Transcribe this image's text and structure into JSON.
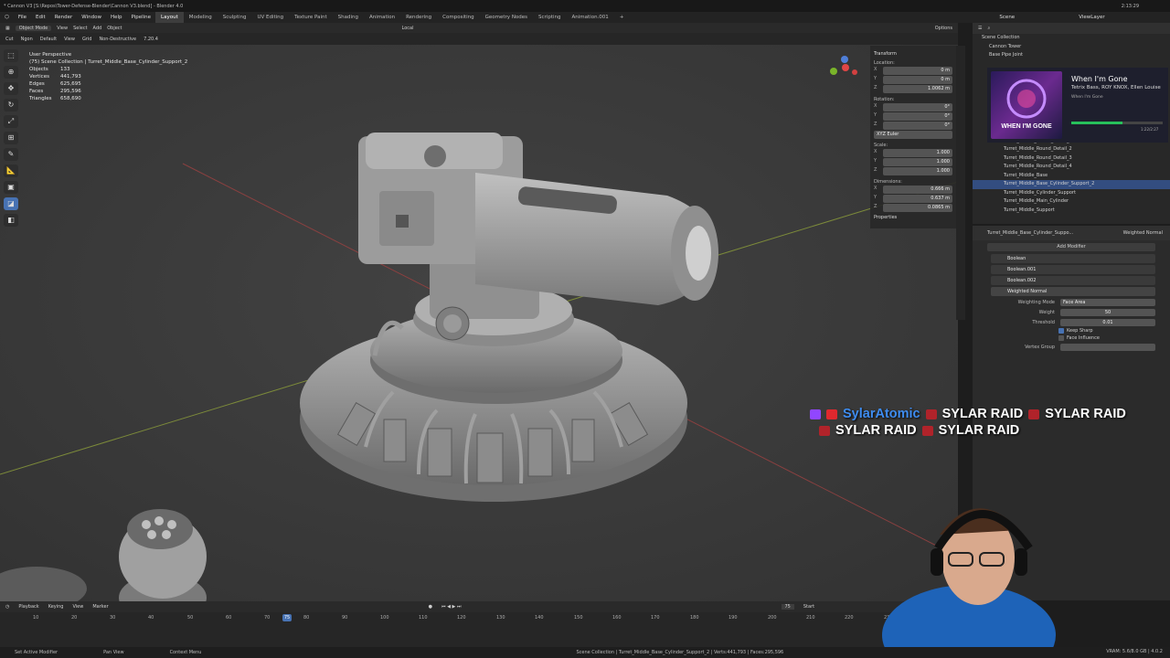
{
  "window_title": "* Cannon V3 [S:\\Repos\\Tower-Defense-Blender\\Cannon V3.blend] - Blender 4.0",
  "clock": "2:13:29",
  "menu": [
    "File",
    "Edit",
    "Render",
    "Window",
    "Help",
    "Pipeline"
  ],
  "workspaces": [
    "Layout",
    "Modeling",
    "Sculpting",
    "UV Editing",
    "Texture Paint",
    "Shading",
    "Animation",
    "Rendering",
    "Compositing",
    "Geometry Nodes",
    "Scripting",
    "Animation.001"
  ],
  "active_workspace": "Layout",
  "header3d": {
    "mode": "Object Mode",
    "view": "View",
    "select": "Select",
    "add": "Add",
    "object": "Object",
    "orientation": "Local",
    "options": "Options"
  },
  "toolbar2": {
    "cut": "Cut",
    "ngon": "Ngon",
    "default": "Default",
    "view": "View",
    "grid": "Grid",
    "nondestructive": "Non-Destructive",
    "version": "7.20.4"
  },
  "stats": {
    "perspective": "User Perspective",
    "collection": "(75) Scene Collection | Turret_Middle_Base_Cylinder_Support_2",
    "rows": [
      {
        "k": "Objects",
        "v": "133"
      },
      {
        "k": "Vertices",
        "v": "441,793"
      },
      {
        "k": "Edges",
        "v": "625,695"
      },
      {
        "k": "Faces",
        "v": "295,596"
      },
      {
        "k": "Triangles",
        "v": "658,690"
      }
    ]
  },
  "npanel": {
    "transform": "Transform",
    "location": "Location:",
    "loc": [
      {
        "a": "X",
        "v": "0 m"
      },
      {
        "a": "Y",
        "v": "0 m"
      },
      {
        "a": "Z",
        "v": "1.0062 m"
      }
    ],
    "rotation": "Rotation:",
    "rot": [
      {
        "a": "X",
        "v": "0°"
      },
      {
        "a": "Y",
        "v": "0°"
      },
      {
        "a": "Z",
        "v": "0°"
      }
    ],
    "euler": "XYZ Euler",
    "scale": "Scale:",
    "sca": [
      {
        "a": "X",
        "v": "1.000"
      },
      {
        "a": "Y",
        "v": "1.000"
      },
      {
        "a": "Z",
        "v": "1.000"
      }
    ],
    "dimensions": "Dimensions:",
    "dim": [
      {
        "a": "X",
        "v": "0.666 m"
      },
      {
        "a": "Y",
        "v": "0.637 m"
      },
      {
        "a": "Z",
        "v": "0.0865 m"
      }
    ],
    "properties": "Properties"
  },
  "outliner": {
    "scene": "Scene",
    "viewlayer": "ViewLayer",
    "items": [
      "Scene Collection",
      "Cannon Tower",
      "Base Pipe Joint",
      "Turret_Middle_Round_Detail_1",
      "Turret_Middle_Round_Detail_2",
      "Turret_Middle_Round_Detail_3",
      "Turret_Middle_Round_Detail_4",
      "Turret_Middle_Base",
      "Turret_Middle_Base_Cylinder_Support_2",
      "Turret_Middle_Cylinder_Support",
      "Turret_Middle_Main_Cylinder",
      "Turret_Middle_Support"
    ],
    "selected": "Turret_Middle_Base_Cylinder_Support_2"
  },
  "music": {
    "title": "When I'm Gone",
    "artist": "Tetrix Bass, ROY KNOX, Ellen Louise",
    "album": "When I'm Gone",
    "progress": 0.56,
    "time": "1:22/2:27",
    "art_text": "WHEN I'M GONE"
  },
  "properties": {
    "object": "Turret_Middle_Base_Cylinder_Suppo...",
    "modifier_ctx": "Weighted Normal",
    "add_modifier": "Add Modifier",
    "modifiers": [
      "Boolean",
      "Boolean.001",
      "Boolean.002",
      "Weighted Normal"
    ],
    "weighting_mode_label": "Weighting Mode",
    "weighting_mode": "Face Area",
    "weight_label": "Weight",
    "weight": "50",
    "threshold_label": "Threshold",
    "threshold": "0.01",
    "keep_sharp": "Keep Sharp",
    "face_influence": "Face Influence",
    "vertex_group_label": "Vertex Group"
  },
  "raid": {
    "user": "SylarAtomic",
    "text": "SYLAR RAID"
  },
  "timeline": {
    "playback": "Playback",
    "keying": "Keying",
    "view": "View",
    "marker": "Marker",
    "current_frame": "75",
    "start": "Start",
    "ticks": [
      "10",
      "20",
      "30",
      "40",
      "50",
      "60",
      "70",
      "80",
      "90",
      "100",
      "110",
      "120",
      "130",
      "140",
      "150",
      "160",
      "170",
      "180",
      "190",
      "200",
      "210",
      "220",
      "230"
    ]
  },
  "status": {
    "select": "Set Active Modifier",
    "pan": "Pan View",
    "context": "Context Menu",
    "info": "Scene Collection | Turret_Middle_Base_Cylinder_Support_2 | Verts:441,793 | Faces:295,596",
    "vram": "VRAM: 5.6/8.0 GB | 4.0.2"
  },
  "colors": {
    "accent": "#4772b3",
    "select": "#334d80",
    "raid_user": "#3e8cf0",
    "twitch": "#9146ff",
    "red": "#e0282e"
  }
}
